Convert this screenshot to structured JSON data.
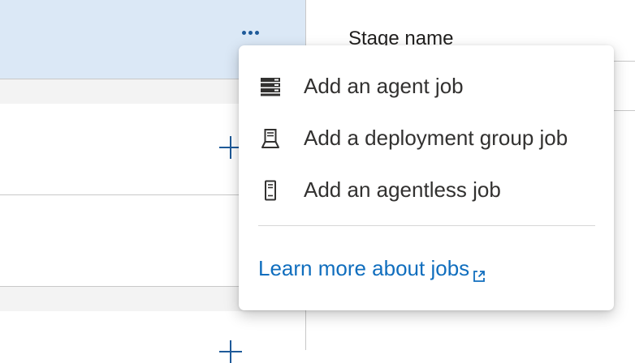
{
  "stage": {
    "more_options_icon": "ellipsis-icon"
  },
  "pipeline": {
    "add_job_icon": "plus-icon"
  },
  "properties": {
    "stage_name_label": "Stage name"
  },
  "menu": {
    "items": [
      {
        "icon": "agent-job-server-icon",
        "label": "Add an agent job"
      },
      {
        "icon": "deployment-group-icon",
        "label": "Add a deployment group job"
      },
      {
        "icon": "agentless-job-icon",
        "label": "Add an agentless job"
      }
    ],
    "learn_more": {
      "label": "Learn more about jobs",
      "icon": "external-link-icon"
    }
  },
  "colors": {
    "stage_header_bg": "#dbe8f6",
    "accent": "#106ebe",
    "icon_blue": "#1e5a99"
  }
}
